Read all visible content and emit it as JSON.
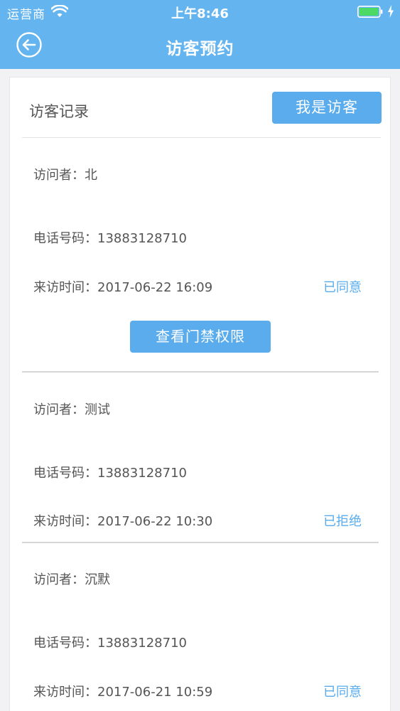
{
  "status_bar": {
    "carrier": "运营商",
    "time": "上午8:46"
  },
  "nav": {
    "title": "访客预约",
    "back_icon": "back-arrow-circle-icon"
  },
  "card": {
    "title": "访客记录",
    "visitor_button": "我是访客"
  },
  "labels": {
    "visitor": "访问者：",
    "phone": "电话号码：",
    "visit_time": "来访时间："
  },
  "records": [
    {
      "name": "北",
      "phone": "13883128710",
      "time": "2017-06-22 16:09",
      "status": "已同意",
      "action": "查看门禁权限"
    },
    {
      "name": "测试",
      "phone": "13883128710",
      "time": "2017-06-22 10:30",
      "status": "已拒绝"
    },
    {
      "name": "沉默",
      "phone": "13883128710",
      "time": "2017-06-21 10:59",
      "status": "已同意"
    }
  ],
  "colors": {
    "header": "#64b5ef",
    "accent": "#5aacec",
    "text": "#555555",
    "battery": "#4cd964"
  }
}
